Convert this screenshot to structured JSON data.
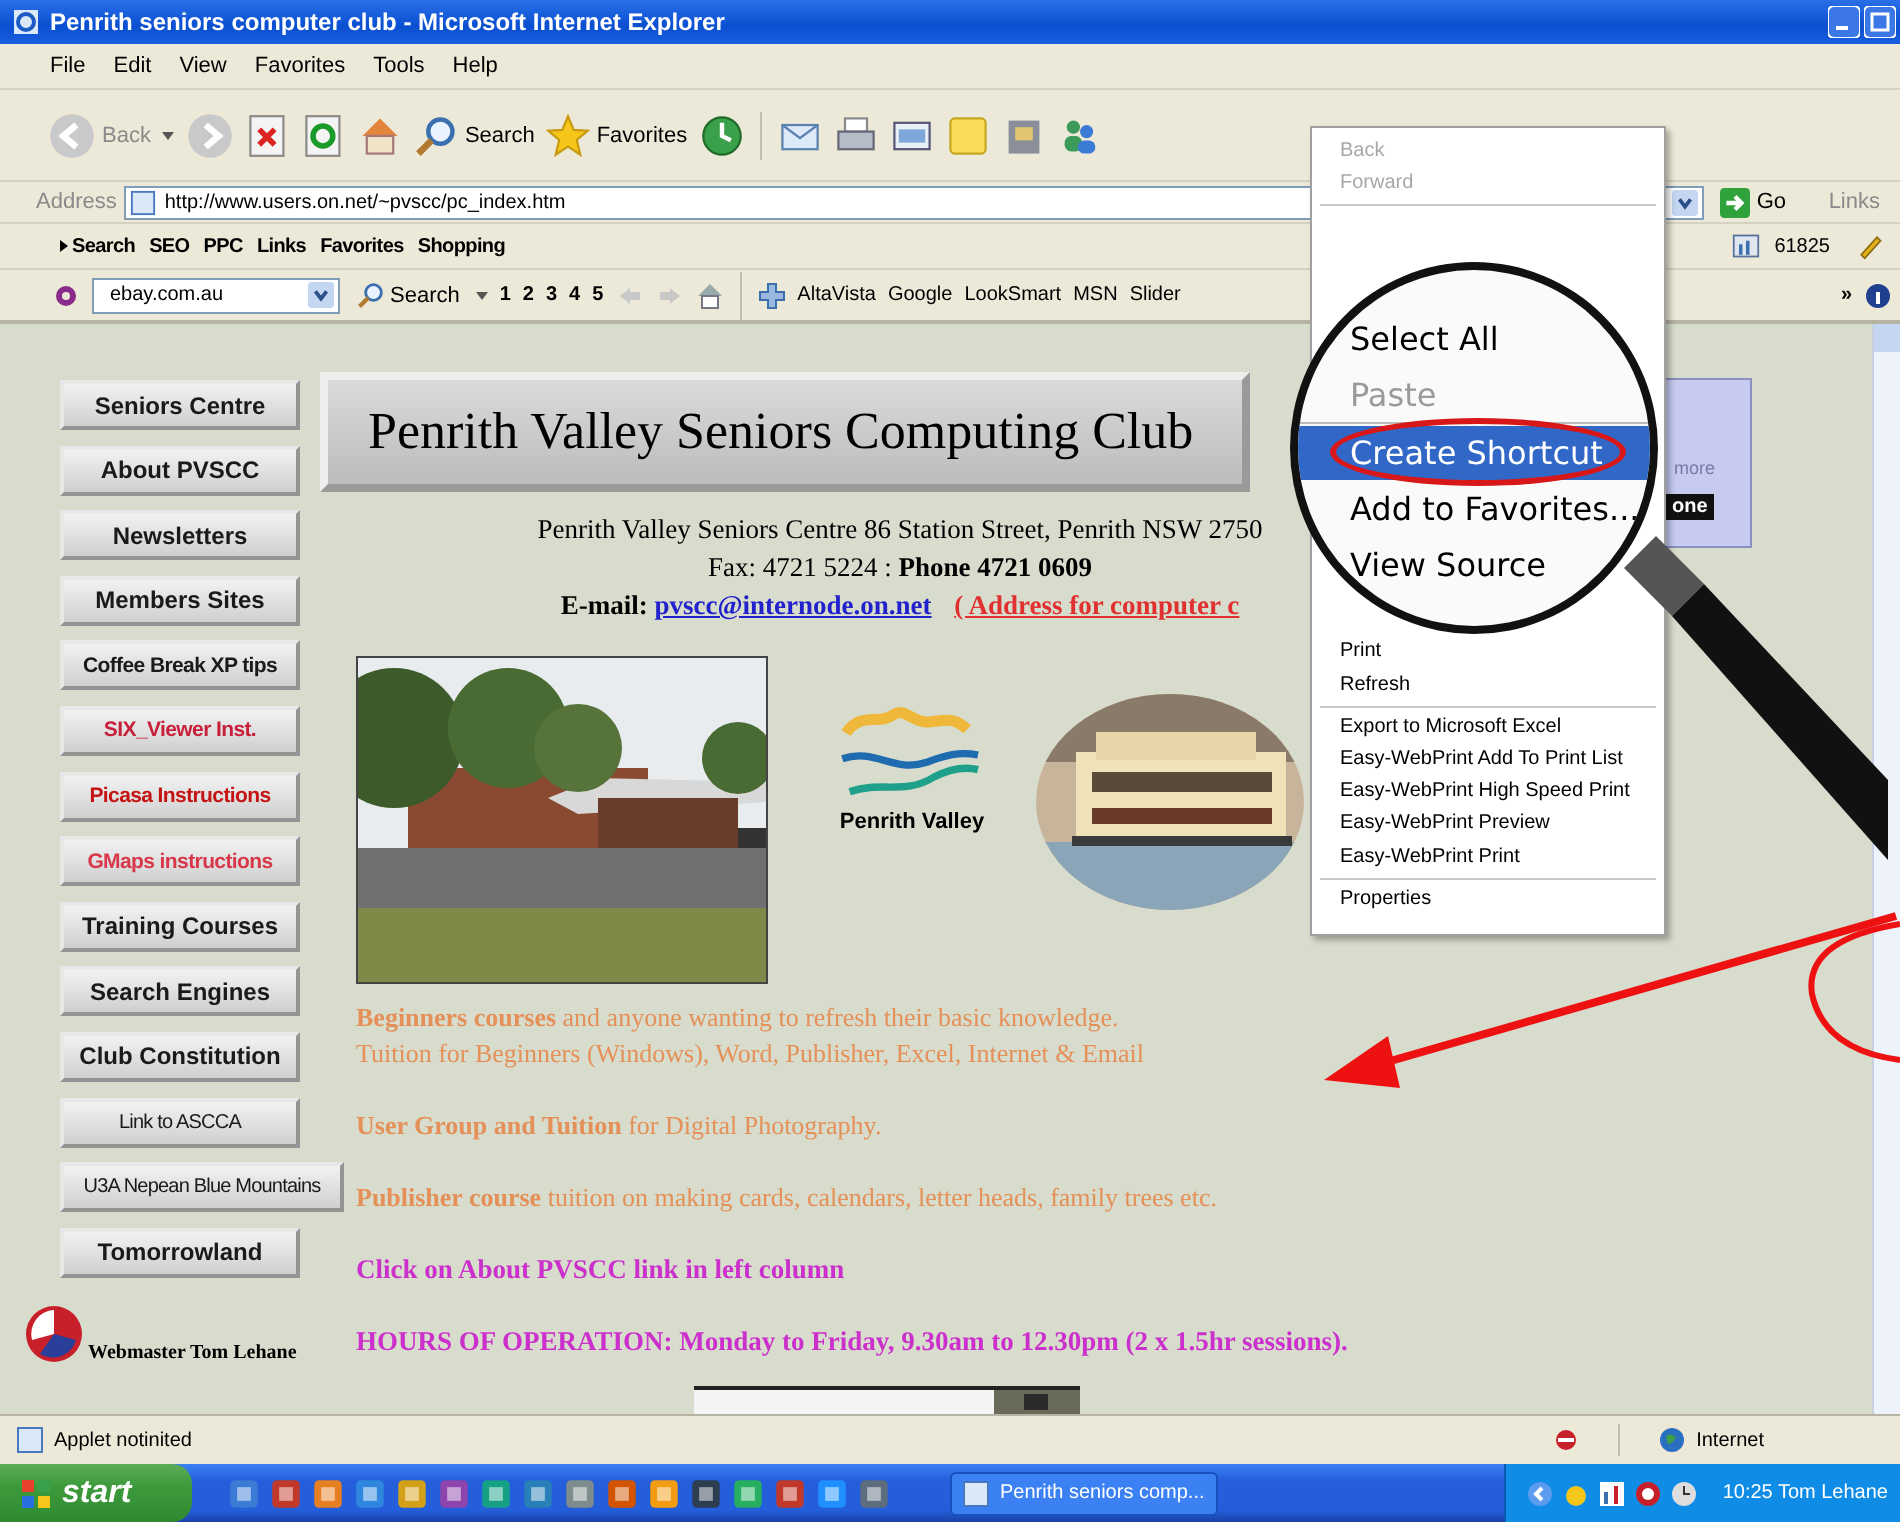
{
  "window": {
    "title": "Penrith seniors computer club - Microsoft Internet Explorer"
  },
  "menu": [
    "File",
    "Edit",
    "View",
    "Favorites",
    "Tools",
    "Help"
  ],
  "toolbar": {
    "back": "Back",
    "search": "Search",
    "favorites": "Favorites"
  },
  "address": {
    "label": "Address",
    "value": "http://www.users.on.net/~pvscc/pc_index.htm",
    "go": "Go",
    "links": "Links"
  },
  "links_bar": {
    "items": [
      "Search",
      "SEO",
      "PPC",
      "Links",
      "Favorites",
      "Shopping"
    ],
    "counter": "61825"
  },
  "search_bar": {
    "query": "ebay.com.au",
    "search": "Search",
    "pages": [
      "1",
      "2",
      "3",
      "4",
      "5"
    ],
    "engines": [
      "AltaVista",
      "Google",
      "LookSmart",
      "MSN",
      "Slider"
    ],
    "more": "»"
  },
  "nav": [
    {
      "label": "Seniors Centre",
      "kind": "large",
      "color": "#1a1a1a"
    },
    {
      "label": "About PVSCC",
      "kind": "large",
      "color": "#1a1a1a"
    },
    {
      "label": "Newsletters",
      "kind": "large",
      "color": "#1a1a1a"
    },
    {
      "label": "Members Sites",
      "kind": "large",
      "color": "#1a1a1a"
    },
    {
      "label": "Coffee Break XP tips",
      "kind": "small",
      "color": "#1a1a1a"
    },
    {
      "label": "SIX_Viewer Inst.",
      "kind": "small",
      "color": "#c8203a"
    },
    {
      "label": "Picasa Instructions",
      "kind": "small",
      "color": "#c41414"
    },
    {
      "label": "GMaps instructions",
      "kind": "small",
      "color": "#d8384a"
    },
    {
      "label": "Training Courses",
      "kind": "large",
      "color": "#1a1a1a"
    },
    {
      "label": "Search Engines",
      "kind": "large",
      "color": "#1a1a1a"
    },
    {
      "label": "Club Constitution",
      "kind": "large",
      "color": "#1a1a1a"
    },
    {
      "label": "Link to ASCCA",
      "kind": "plain",
      "color": "#1a1a1a"
    },
    {
      "label": "U3A Nepean Blue Mountains",
      "kind": "plain",
      "color": "#1a1a1a"
    },
    {
      "label": "Tomorrowland",
      "kind": "large",
      "color": "#1a1a1a"
    }
  ],
  "webmaster": "Webmaster Tom Lehane",
  "banner": "Penrith Valley Seniors Computing Club",
  "contact": {
    "address": "Penrith Valley Seniors Centre  86 Station Street, Penrith NSW 2750",
    "phone": "Fax: 4721 5224 : **Phone 4721 0609**",
    "email_label": "E-mail:",
    "email": "pvscc@internode.on.net",
    "note": "( Address for computer c"
  },
  "logo": "Penrith Valley",
  "paragraphs": [
    {
      "kind": "course",
      "lines": [
        "**Beginners courses** and anyone wanting to refresh their basic knowledge.",
        "Tuition for Beginners (Windows), Word, Publisher, Excel, Internet & Email"
      ]
    },
    {
      "kind": "course",
      "lines": [
        "**User Group and Tuition** for Digital Photography."
      ]
    },
    {
      "kind": "course",
      "lines": [
        "**Publisher course** tuition on making cards, calendars, letter heads, family trees etc."
      ]
    },
    {
      "kind": "notice",
      "lines": [
        "Click on About PVSCC link in left column"
      ]
    },
    {
      "kind": "notice",
      "lines": [
        "HOURS OF OPERATION:  Monday to Friday, 9.30am to 12.30pm (2 x 1.5hr sessions)."
      ]
    }
  ],
  "side_panel": {
    "text": "more",
    "label": "one"
  },
  "context_menu": {
    "top_items": [
      {
        "label": "Back",
        "disabled": true
      },
      {
        "label": "Forward",
        "disabled": true
      }
    ],
    "bottom_items": [
      {
        "kind": "item",
        "label": "Print",
        "disabled": false
      },
      {
        "kind": "item",
        "label": "Refresh",
        "disabled": false
      },
      {
        "kind": "separator"
      },
      {
        "kind": "item",
        "label": "Export to Microsoft Excel",
        "disabled": false
      },
      {
        "kind": "item",
        "label": "Easy-WebPrint Add To Print List",
        "disabled": false
      },
      {
        "kind": "item",
        "label": "Easy-WebPrint High Speed Print",
        "disabled": false
      },
      {
        "kind": "item",
        "label": "Easy-WebPrint Preview",
        "disabled": false
      },
      {
        "kind": "item",
        "label": "Easy-WebPrint Print",
        "disabled": false
      },
      {
        "kind": "separator"
      },
      {
        "kind": "item",
        "label": "Properties",
        "disabled": false
      }
    ]
  },
  "magnifier": {
    "items": [
      {
        "label": "Select All",
        "disabled": false,
        "selected": false,
        "circled": false
      },
      {
        "label": "Paste",
        "disabled": true,
        "selected": false,
        "circled": false
      },
      {
        "label": "Create Shortcut",
        "disabled": false,
        "selected": true,
        "circled": true
      },
      {
        "label": "Add to Favorites...",
        "disabled": false,
        "selected": false,
        "circled": false
      },
      {
        "label": "View Source",
        "disabled": false,
        "selected": false,
        "circled": false
      }
    ]
  },
  "status_bar": {
    "text": "Applet notinited",
    "zone": "Internet"
  },
  "taskbar": {
    "start": "start",
    "task": "Penrith seniors comp...",
    "clock": "10:25 Tom Lehane"
  }
}
